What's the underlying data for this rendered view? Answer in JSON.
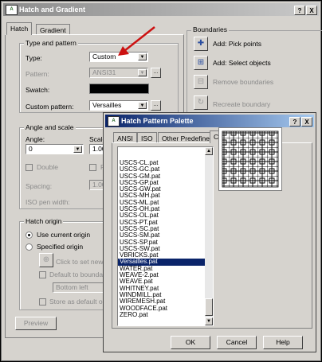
{
  "main_dialog": {
    "title": "Hatch and Gradient",
    "tabs": [
      "Hatch",
      "Gradient"
    ],
    "type_and_pattern": {
      "group_title": "Type and pattern",
      "type_label": "Type:",
      "type_value": "Custom",
      "pattern_label": "Pattern:",
      "pattern_value": "ANSI31",
      "swatch_label": "Swatch:",
      "custom_pattern_label": "Custom pattern:",
      "custom_pattern_value": "Versailles"
    },
    "angle_and_scale": {
      "group_title": "Angle and scale",
      "angle_label": "Angle:",
      "angle_value": "0",
      "scale_label": "Scale",
      "scale_value": "1.000",
      "double_label": "Double",
      "relative_label": "R",
      "spacing_label": "Spacing:",
      "spacing_value": "1.000",
      "iso_pen_label": "ISO pen width:"
    },
    "hatch_origin": {
      "group_title": "Hatch origin",
      "use_current_label": "Use current origin",
      "specified_label": "Specified origin",
      "click_to_set_label": "Click to set new or",
      "default_boundary_label": "Default to boundary e",
      "bottom_left_value": "Bottom left",
      "store_default_label": "Store as default origin"
    },
    "preview_button": "Preview",
    "boundaries": {
      "group_title": "Boundaries",
      "add_pick_points": "Add: Pick points",
      "add_select_objects": "Add: Select objects",
      "remove_boundaries": "Remove boundaries",
      "recreate_boundary": "Recreate boundary"
    }
  },
  "palette_dialog": {
    "title": "Hatch Pattern Palette",
    "tabs": [
      "ANSI",
      "ISO",
      "Other Predefined",
      "Custom"
    ],
    "patterns": [
      {
        "name": "USCS-CL.pat",
        "selected": false
      },
      {
        "name": "USCS-GC.pat",
        "selected": false
      },
      {
        "name": "USCS-GM.pat",
        "selected": false
      },
      {
        "name": "USCS-GP.pat",
        "selected": false
      },
      {
        "name": "USCS-GW.pat",
        "selected": false
      },
      {
        "name": "USCS-MH.pat",
        "selected": false
      },
      {
        "name": "USCS-ML.pat",
        "selected": false
      },
      {
        "name": "USCS-OH.pat",
        "selected": false
      },
      {
        "name": "USCS-OL.pat",
        "selected": false
      },
      {
        "name": "USCS-PT.pat",
        "selected": false
      },
      {
        "name": "USCS-SC.pat",
        "selected": false
      },
      {
        "name": "USCS-SM.pat",
        "selected": false
      },
      {
        "name": "USCS-SP.pat",
        "selected": false
      },
      {
        "name": "USCS-SW.pat",
        "selected": false
      },
      {
        "name": "VBRICKS.pat",
        "selected": false
      },
      {
        "name": "Versailles.pat",
        "selected": true
      },
      {
        "name": "WATER.pat",
        "selected": false
      },
      {
        "name": "WEAVE-2.pat",
        "selected": false
      },
      {
        "name": "WEAVE.pat",
        "selected": false
      },
      {
        "name": "WHITNEY.pat",
        "selected": false
      },
      {
        "name": "WINDMILL.pat",
        "selected": false
      },
      {
        "name": "WIREMESH.pat",
        "selected": false
      },
      {
        "name": "WOODFACE.pat",
        "selected": false
      },
      {
        "name": "ZERO.pat",
        "selected": false
      }
    ],
    "ok_button": "OK",
    "cancel_button": "Cancel",
    "help_button": "Help"
  },
  "title_buttons": {
    "help": "?",
    "close": "X"
  },
  "colors": {
    "selection": "#0a246a",
    "arrow": "#cc1111",
    "dialog_bg": "#d6d3ce"
  }
}
